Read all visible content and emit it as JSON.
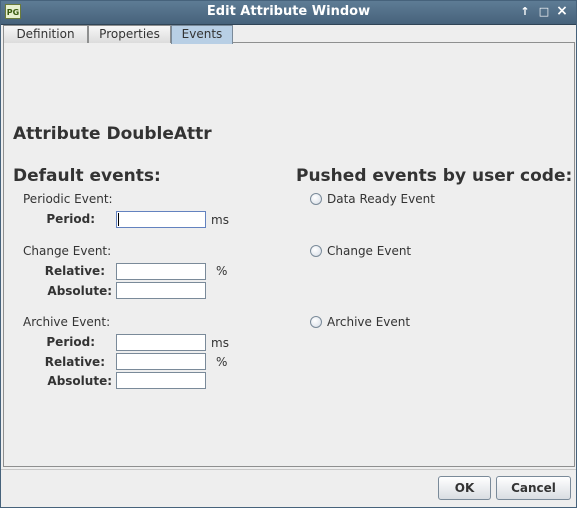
{
  "window": {
    "title": "Edit Attribute Window",
    "icon_text": "PG",
    "controls": {
      "pin": "↑",
      "maximize": "□",
      "close": "×"
    }
  },
  "tabs": [
    {
      "label": "Definition",
      "selected": false
    },
    {
      "label": "Properties",
      "selected": false
    },
    {
      "label": "Events",
      "selected": true
    }
  ],
  "attribute_title": "Attribute DoubleAttr",
  "default_events": {
    "heading": "Default events:",
    "periodic": {
      "title": "Periodic Event:",
      "period_label": "Period:",
      "period_value": "",
      "period_unit": "ms"
    },
    "change": {
      "title": "Change Event:",
      "relative_label": "Relative:",
      "relative_value": "",
      "relative_unit": "%",
      "absolute_label": "Absolute:",
      "absolute_value": ""
    },
    "archive": {
      "title": "Archive Event:",
      "period_label": "Period:",
      "period_value": "",
      "period_unit": "ms",
      "relative_label": "Relative:",
      "relative_value": "",
      "relative_unit": "%",
      "absolute_label": "Absolute:",
      "absolute_value": ""
    }
  },
  "pushed_events": {
    "heading": "Pushed events by user code:",
    "options": [
      {
        "label": "Data Ready Event",
        "checked": false
      },
      {
        "label": "Change Event",
        "checked": false
      },
      {
        "label": "Archive Event",
        "checked": false
      }
    ]
  },
  "buttons": {
    "ok": "OK",
    "cancel": "Cancel"
  },
  "colors": {
    "titlebar": "#46627b",
    "selected_tab": "#b8cfe5",
    "background": "#eeeeee"
  }
}
